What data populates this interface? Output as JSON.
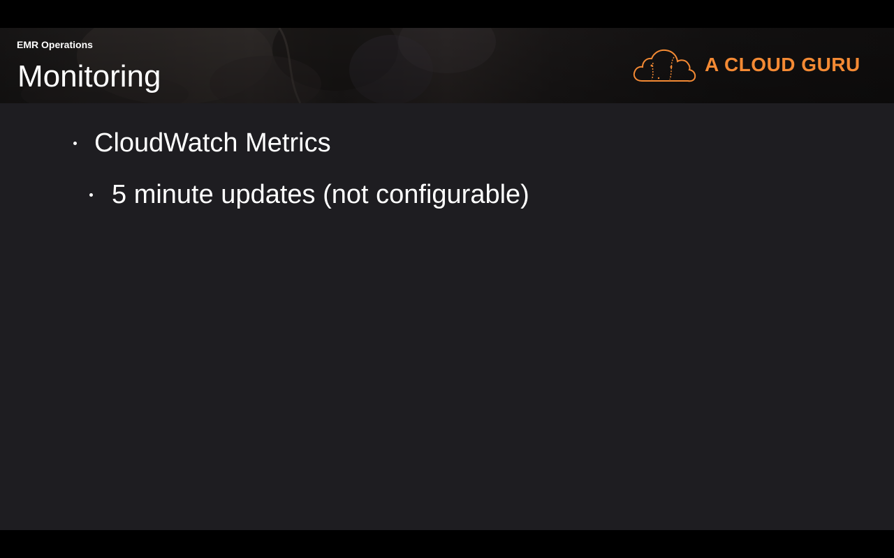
{
  "slide": {
    "section_label": "EMR Operations",
    "title": "Monitoring",
    "logo_text": "A CLOUD GURU",
    "logo_icon": "cloud-logo-icon",
    "accent_color": "#f48a34",
    "background_color": "#1e1d21",
    "bullets": [
      {
        "level": 1,
        "text": "CloudWatch Metrics"
      },
      {
        "level": 2,
        "text": "5 minute updates (not configurable)"
      }
    ]
  }
}
